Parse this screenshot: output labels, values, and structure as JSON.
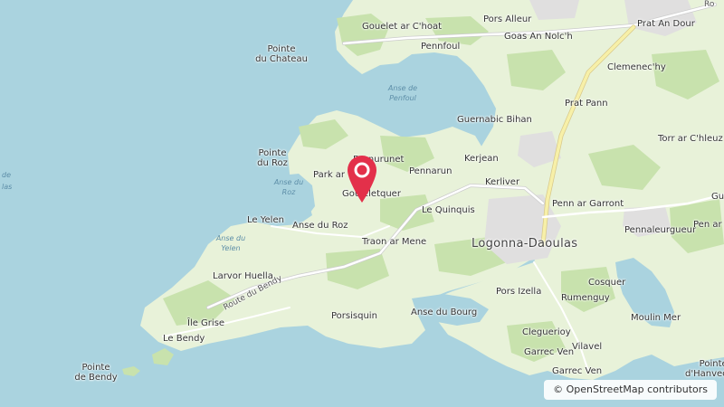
{
  "map": {
    "colors": {
      "sea": "#aad3df",
      "land": "#e8f2d9",
      "forest": "#c8e2ad",
      "urban": "#e0dfdf",
      "road": "#ffffff",
      "main_road": "#f7f0a8",
      "marker": "#e3304a"
    },
    "labels": {
      "pointe_du_chateau": "Pointe\ndu Chateau",
      "gouelet_ar_choat": "Gouelet ar C'hoat",
      "pennfoul": "Pennfoul",
      "pors_alleur": "Pors Alleur",
      "goas_an_nolch": "Goas An Nolc'h",
      "prat_an_dour": "Prat An Dour",
      "anse_de_penfoul": "Anse de\nPenfoul",
      "clemenechy": "Clemenec'hy",
      "guernabic_bihan": "Guernabic Bihan",
      "prat_pann": "Prat Pann",
      "torr_ar_chleuz": "Torr ar C'hleuz",
      "pointe_du_roz": "Pointe\ndu Roz",
      "park_ar": "Park ar",
      "brenurunet": "Brenurunet",
      "pennarun": "Pennarun",
      "kerjean": "Kerjean",
      "kerliver": "Kerliver",
      "anse_du_roz_water": "Anse du\nRoz",
      "gouleletquer": "Gouleletquer",
      "le_quinquis": "Le Quinquis",
      "penn_ar_garront": "Penn ar Garront",
      "le_yelen": "Le Yelen",
      "anse_du_roz": "Anse du Roz",
      "traon_ar_mene": "Traon ar Mene",
      "logonna_daoulas": "Logonna-Daoulas",
      "pennaleurgueur": "Pennaleurgueur",
      "pen_ar_edge": "Pen ar",
      "anse_du_yelen": "Anse du\nYelen",
      "larvor_huella": "Larvor Huella",
      "route_du_bendy": "Route du Bendy",
      "pors_izella": "Pors Izella",
      "rumenguy": "Rumenguy",
      "cosquer": "Cosquer",
      "porsisquin": "Porsisquin",
      "anse_du_bourg": "Anse du Bourg",
      "moulin_mer": "Moulin Mer",
      "ile_grise": "Île Grise",
      "cleguerioy": "Cleguerioy",
      "le_bendy": "Le Bendy",
      "vilavel": "Vilavel",
      "garrec_ven": "Garrec Ven",
      "garrec_ven_2": "Garrec Ven",
      "pointe_de_bendy": "Pointe\nde Bendy",
      "pointe_dhanvec": "Pointe\nd'Hanvec",
      "gu_edge": "Gu",
      "de_edge": "de",
      "las_edge": "las",
      "ro_edge": "Ro"
    },
    "marker_icon": "map-pin-icon",
    "attribution": "© OpenStreetMap contributors"
  }
}
